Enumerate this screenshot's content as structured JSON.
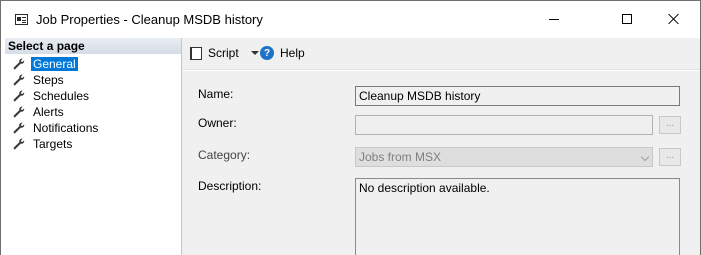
{
  "window": {
    "title": "Job Properties - Cleanup MSDB history"
  },
  "left_pane": {
    "header": "Select a page",
    "items": [
      {
        "label": "General",
        "selected": true
      },
      {
        "label": "Steps"
      },
      {
        "label": "Schedules"
      },
      {
        "label": "Alerts"
      },
      {
        "label": "Notifications"
      },
      {
        "label": "Targets"
      }
    ]
  },
  "toolbar": {
    "script_label": "Script",
    "help_label": "Help",
    "help_glyph": "?"
  },
  "form": {
    "name_label": "Name:",
    "name_value": "Cleanup MSDB history",
    "owner_label": "Owner:",
    "owner_value": "",
    "owner_button": "...",
    "category_label": "Category:",
    "category_value": "Jobs from MSX",
    "category_button": "...",
    "description_label": "Description:",
    "description_value": "No description available."
  },
  "colors": {
    "selection": "#0078d7",
    "help_icon": "#1e73c8",
    "content_bg": "#f0f0f0"
  }
}
